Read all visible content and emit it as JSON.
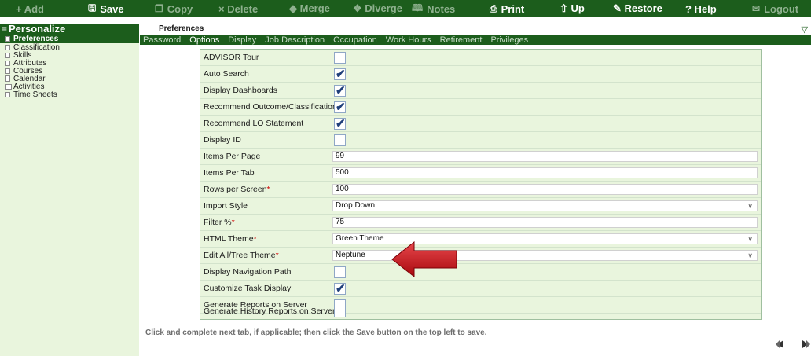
{
  "toolbar": {
    "add": "+ Add",
    "save": "Save",
    "copy": "Copy",
    "delete": "× Delete",
    "merge": "◆ Merge",
    "diverge": "❖ Diverge",
    "notes": "Notes",
    "print": "Print",
    "up": "⇧ Up",
    "restore": "✎ Restore",
    "help": "? Help",
    "logout": "Logout"
  },
  "sidebar": {
    "title": "Personalize",
    "items": [
      {
        "label": "Preferences",
        "active": true
      },
      {
        "label": "Classification"
      },
      {
        "label": "Skills"
      },
      {
        "label": "Attributes"
      },
      {
        "label": "Courses"
      },
      {
        "label": "Calendar"
      },
      {
        "label": "Activities"
      },
      {
        "label": "Time Sheets"
      }
    ]
  },
  "breadcrumb": "Preferences",
  "tabs": [
    "Password",
    "Options",
    "Display",
    "Job Description",
    "Occupation",
    "Work Hours",
    "Retirement",
    "Privileges"
  ],
  "active_tab": "Options",
  "form": {
    "rows": [
      {
        "label": "ADVISOR Tour",
        "type": "checkbox",
        "checked": false
      },
      {
        "label": "Auto Search",
        "type": "checkbox",
        "checked": true
      },
      {
        "label": "Display Dashboards",
        "type": "checkbox",
        "checked": true
      },
      {
        "label": "Recommend Outcome/Classification",
        "type": "checkbox",
        "checked": true
      },
      {
        "label": "Recommend LO Statement",
        "type": "checkbox",
        "checked": true
      },
      {
        "label": "Display ID",
        "type": "checkbox",
        "checked": false
      },
      {
        "label": "Items Per Page",
        "type": "text",
        "value": "99"
      },
      {
        "label": "Items Per Tab",
        "type": "text",
        "value": "500"
      },
      {
        "label": "Rows per Screen",
        "required": true,
        "type": "text",
        "value": "100"
      },
      {
        "label": "Import Style",
        "type": "select",
        "value": "Drop Down"
      },
      {
        "label": "Filter %",
        "required": true,
        "type": "text",
        "value": "75"
      },
      {
        "label": "HTML Theme",
        "required": true,
        "type": "select",
        "value": "Green Theme"
      },
      {
        "label": "Edit All/Tree Theme",
        "required": true,
        "type": "select",
        "value": "Neptune"
      },
      {
        "label": "Display Navigation Path",
        "type": "checkbox",
        "checked": false
      },
      {
        "label": "Customize Task Display",
        "type": "checkbox",
        "checked": true
      },
      {
        "label": "Generate Reports on Server",
        "type": "checkbox",
        "checked": false
      },
      {
        "label": "Generate History Reports on Server",
        "type": "checkbox",
        "checked": false
      }
    ]
  },
  "hint": "Click and complete next tab, if applicable; then click the Save button on the top left to save.",
  "colors": {
    "brand_green": "#1c5d1c",
    "panel_bg": "#e9f5dd",
    "arrow_red": "#c0141a"
  }
}
